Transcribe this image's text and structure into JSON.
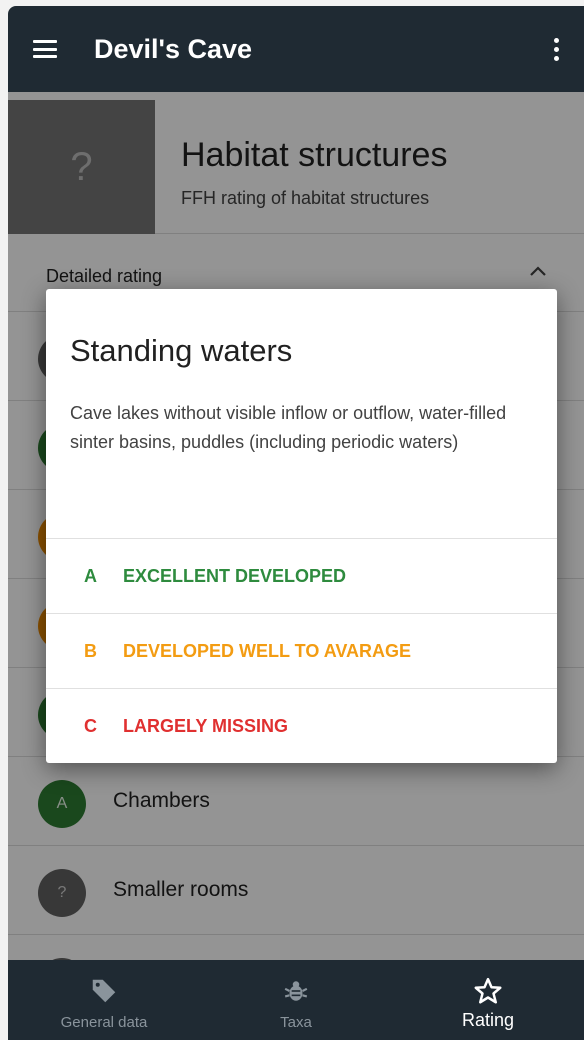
{
  "app_bar": {
    "title": "Devil's Cave"
  },
  "header": {
    "thumb_placeholder": "?",
    "title": "Habitat structures",
    "subtitle": "FFH rating of habitat structures"
  },
  "section": {
    "title": "Detailed rating"
  },
  "list": [
    {
      "rating": "A",
      "label": "Chambers",
      "color": "#2e7d32"
    },
    {
      "rating": "?",
      "label": "Smaller rooms",
      "color": "#616161"
    }
  ],
  "dialog": {
    "title": "Standing waters",
    "description": "Cave lakes without visible inflow or outflow, water-filled sinter basins, puddles (including periodic waters)",
    "options": [
      {
        "letter": "A",
        "label": "EXCELLENT DEVELOPED",
        "color": "#2e8b3e"
      },
      {
        "letter": "B",
        "label": "DEVELOPED WELL TO AVARAGE",
        "color": "#f39c12"
      },
      {
        "letter": "C",
        "label": "LARGELY MISSING",
        "color": "#e03030"
      }
    ]
  },
  "bottom_nav": {
    "items": [
      {
        "label": "General data",
        "icon": "tag-icon",
        "active": false
      },
      {
        "label": "Taxa",
        "icon": "bug-icon",
        "active": false
      },
      {
        "label": "Rating",
        "icon": "star-outline-icon",
        "active": true
      }
    ]
  },
  "colors": {
    "app_bar": "#1f2a33",
    "background_avatar_partial_grey": "#616161",
    "background_avatar_partial_green": "#2e7d32",
    "background_avatar_partial_orange": "#ef8c00"
  }
}
